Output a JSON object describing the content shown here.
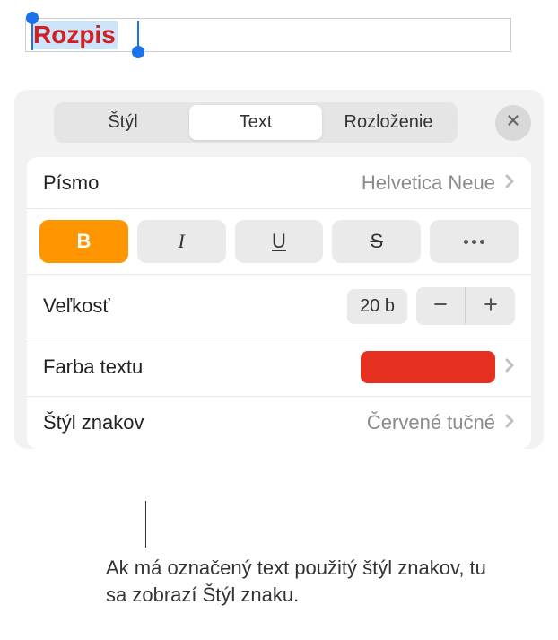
{
  "editor": {
    "selected_text": "Rozpis"
  },
  "tabs": {
    "style": "Štýl",
    "text": "Text",
    "layout": "Rozloženie"
  },
  "rows": {
    "font_label": "Písmo",
    "font_value": "Helvetica Neue",
    "size_label": "Veľkosť",
    "size_value": "20 b",
    "textcolor_label": "Farba textu",
    "textcolor_hex": "#e53020",
    "charstyle_label": "Štýl znakov",
    "charstyle_value": "Červené tučné"
  },
  "style_buttons": {
    "bold": "B",
    "italic": "I",
    "underline": "U",
    "strike": "S"
  },
  "callout": "Ak má označený text použitý štýl znakov, tu sa zobrazí Štýl znaku."
}
